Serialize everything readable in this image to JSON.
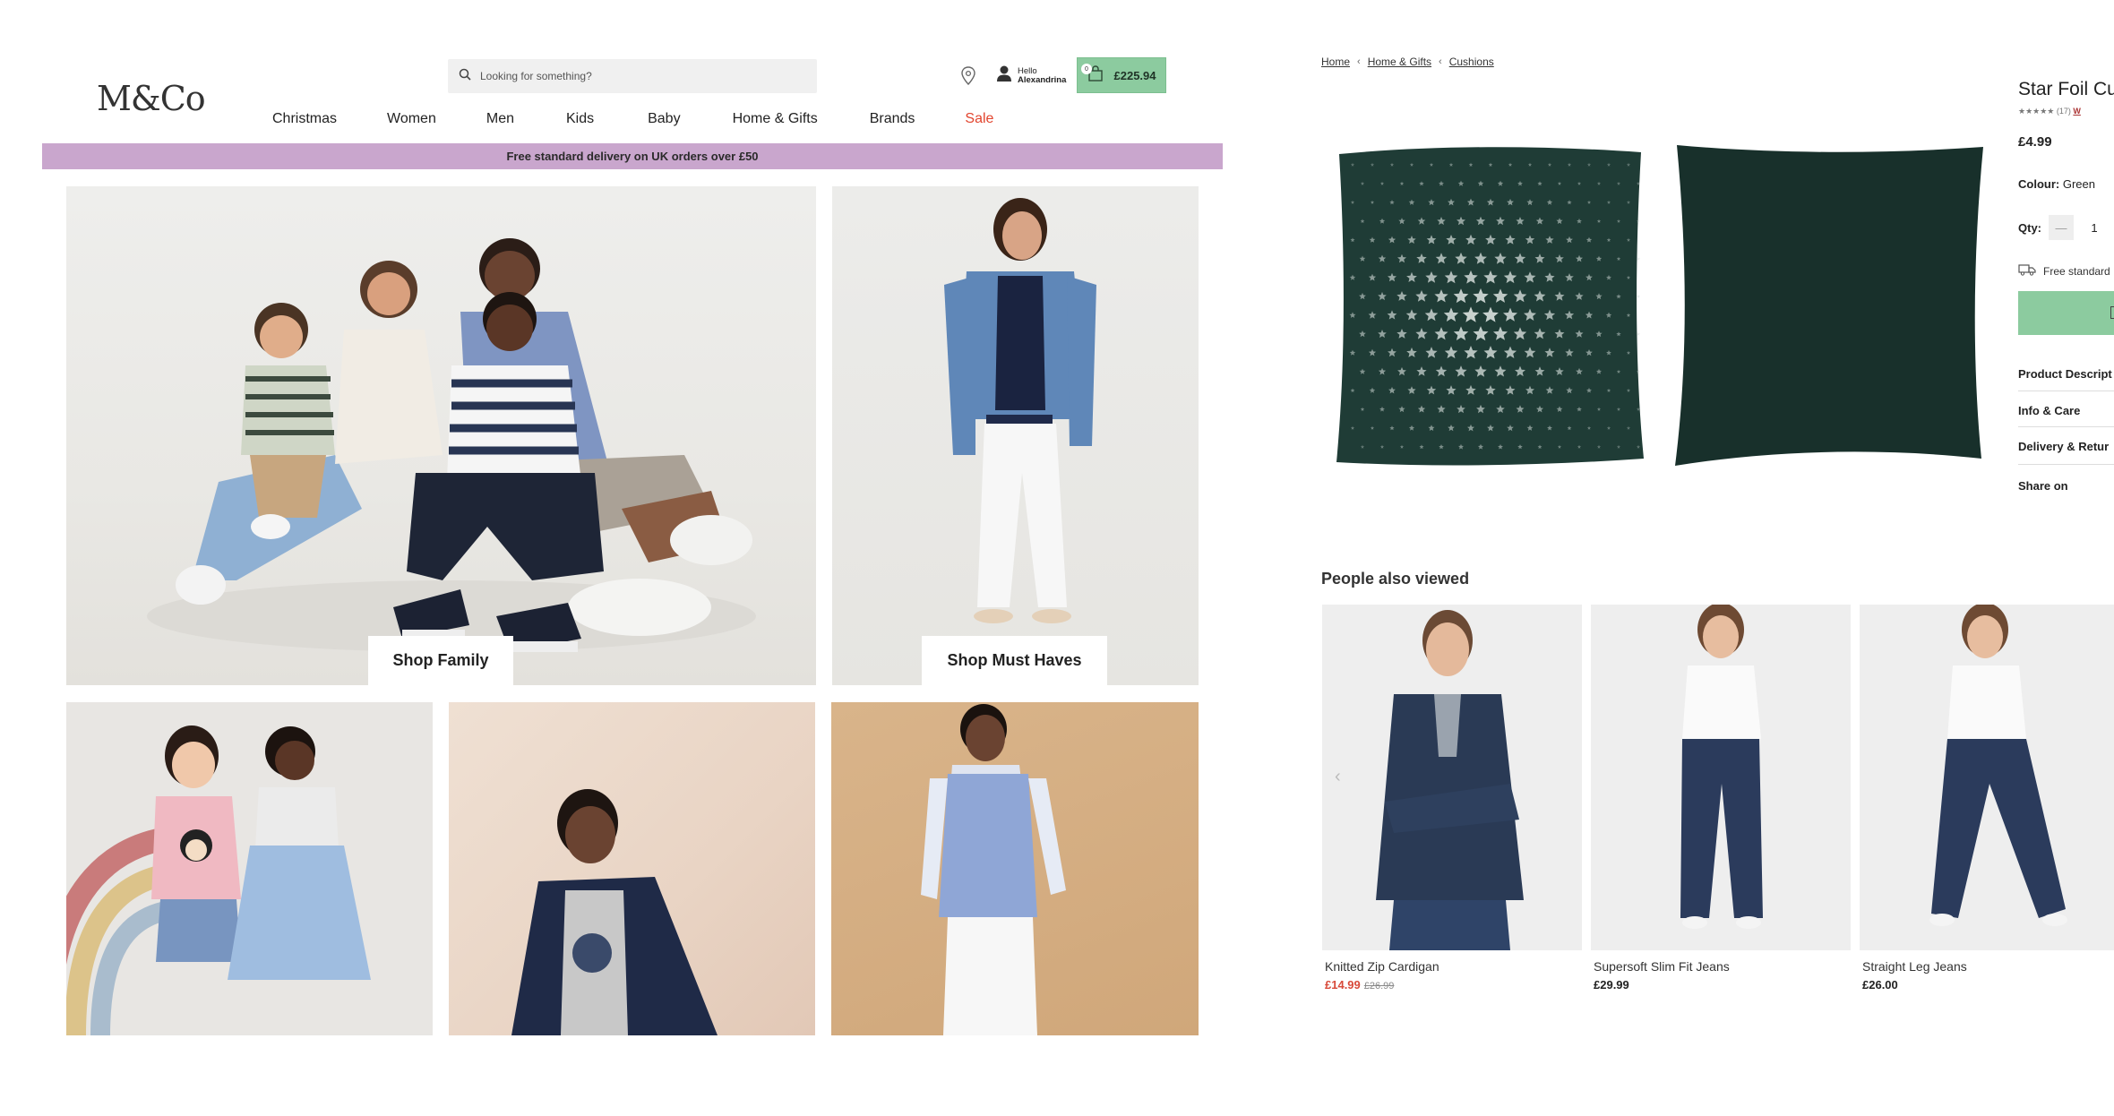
{
  "header": {
    "logo": "M&Co",
    "search_placeholder": "Looking for something?",
    "account_greeting": "Hello",
    "account_name": "Alexandrina",
    "basket_count": "0",
    "basket_total": "£225.94"
  },
  "nav": {
    "items": [
      "Christmas",
      "Women",
      "Men",
      "Kids",
      "Baby",
      "Home & Gifts",
      "Brands",
      "Sale"
    ],
    "sale_color": "#e2452e"
  },
  "promo_bar": {
    "text": "Free standard delivery on UK orders over £50",
    "color": "#c9a6cd"
  },
  "tiles": {
    "family_label": "Shop Family",
    "must_haves_label": "Shop Must Haves"
  },
  "product": {
    "breadcrumb": [
      "Home",
      "Home & Gifts",
      "Cushions"
    ],
    "title": "Star Foil Cu",
    "rating_count": "(17)",
    "rating_link": "W",
    "price": "£4.99",
    "colour_label": "Colour:",
    "colour_value": "Green",
    "qty_label": "Qty:",
    "qty_value": "1",
    "delivery_text": "Free standard",
    "add_button_color": "#8ccb9f",
    "accordions": [
      "Product Descript",
      "Info & Care",
      "Delivery & Retur",
      "Share on"
    ]
  },
  "people_also_viewed": {
    "title": "People also viewed",
    "items": [
      {
        "name": "Knitted Zip Cardigan",
        "price": "£14.99",
        "was_price": "£26.99",
        "on_sale": true
      },
      {
        "name": "Supersoft Slim Fit Jeans",
        "price": "£29.99",
        "on_sale": false
      },
      {
        "name": "Straight Leg Jeans",
        "price": "£26.00",
        "on_sale": false
      }
    ]
  }
}
